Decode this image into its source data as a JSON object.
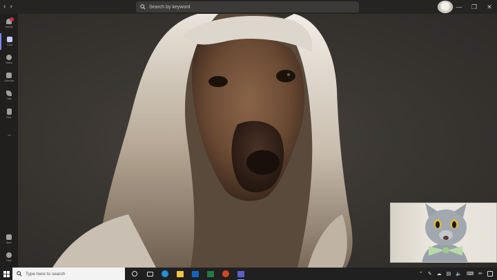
{
  "titlebar": {
    "search_placeholder": "Search by keyword"
  },
  "rail": {
    "items": [
      {
        "label": "Activity",
        "icon": "bell-icon"
      },
      {
        "label": "Chat",
        "icon": "chat-icon"
      },
      {
        "label": "Teams",
        "icon": "teams-icon"
      },
      {
        "label": "Calendar",
        "icon": "calendar-icon"
      },
      {
        "label": "Calls",
        "icon": "phone-icon"
      },
      {
        "label": "Files",
        "icon": "file-icon"
      }
    ],
    "more": "...",
    "bottom": [
      {
        "label": "Apps",
        "icon": "apps-icon"
      },
      {
        "label": "Help",
        "icon": "help-icon"
      }
    ]
  },
  "taskbar": {
    "search_placeholder": "Type here to search"
  },
  "colors": {
    "accent": "#7f85f5",
    "badge": "#c4314b",
    "titlebar": "#252423",
    "rail": "#201f1e",
    "taskbar": "#202020"
  }
}
